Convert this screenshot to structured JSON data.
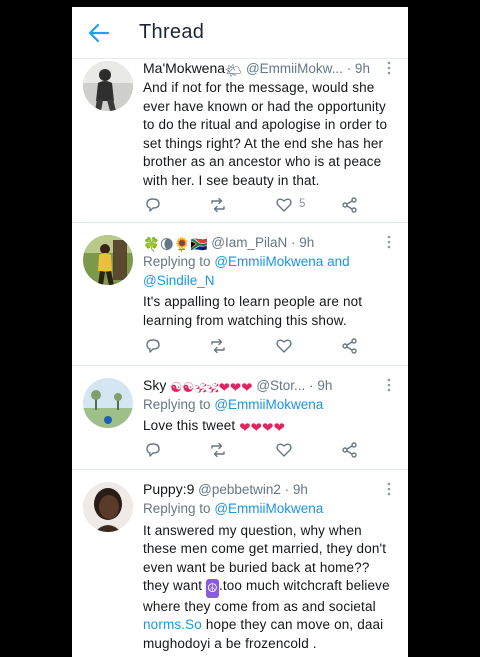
{
  "header": {
    "title": "Thread"
  },
  "colors": {
    "link": "#1b95e0",
    "text": "#14171a",
    "muted": "#657786",
    "accent": "#1da1f2",
    "heart": "#e0245e"
  },
  "tweets": [
    {
      "name": "Ma'Mokwena",
      "name_emoji": "🌤",
      "handle": "@EmmiiMokw...",
      "time": "· 9h",
      "body": "And if not for the message, would she ever have known or had the opportunity to do the ritual and apologise in order to set things right? At the end she has her brother as an ancestor who is at peace with her. I see beauty in that.",
      "like_count": "5"
    },
    {
      "name_emojis": "🍀🌘🌻🇿🇦",
      "handle": "@Iam_PilaN",
      "time": "· 9h",
      "reply_prefix": "Replying to",
      "reply_to_1": "@EmmiiMokwena",
      "reply_and": "and",
      "reply_to_2": "@Sindile_N",
      "body": "It's appalling to learn people are not learning from watching this show."
    },
    {
      "name": "Sky",
      "name_emoji": "☯☯🕉🕉❤❤❤",
      "handle": "@Stor...",
      "time": "· 9h",
      "reply_prefix": "Replying to",
      "reply_to_1": "@EmmiiMokwena",
      "body": "Love this tweet",
      "body_emoji": "❤❤❤❤"
    },
    {
      "name": "Puppy:9",
      "handle": "@pebbetwin2",
      "time": "· 9h",
      "reply_prefix": "Replying to",
      "reply_to_1": "@EmmiiMokwena",
      "body_part1": "It answered my question, why when these men come get married, they don't even want be buried back at home??they want",
      "body_emoji": "☮",
      "body_part2": ".too much witchcraft believe where they come from as and societal",
      "body_link": "norms.So",
      "body_part3": "hope they can move on, daai mughodoyi a be frozencold ."
    }
  ]
}
